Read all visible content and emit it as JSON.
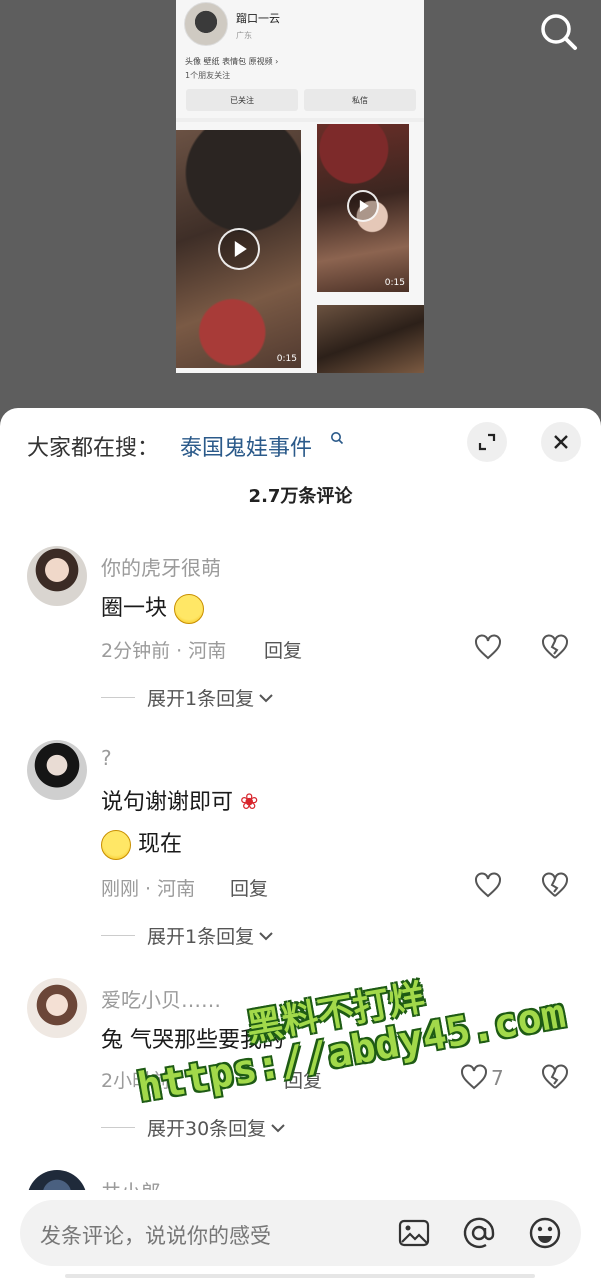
{
  "video_preview": {
    "profile_name": "蹓口一云",
    "location": "广东",
    "tags": "头像 壁纸 表情包 原视频 ›",
    "friends": "1个朋友关注",
    "follow_button": "已关注",
    "message_button": "私信",
    "thumb1_duration": "0:15",
    "thumb2_duration": "0:15"
  },
  "header": {
    "hot_search_prefix": "大家都在搜：",
    "hot_search_term": "泰国鬼娃事件",
    "comment_count": "2.7万条评论"
  },
  "comments": [
    {
      "username": "你的虎牙很萌",
      "text": "圈一块",
      "time_location": "2分钟前 · 河南",
      "reply_label": "回复",
      "expand_label": "展开1条回复"
    },
    {
      "username": "?",
      "text_line1": "说句谢谢即可",
      "text_line2": "现在",
      "time_location": "刚刚 · 河南",
      "reply_label": "回复",
      "expand_label": "展开1条回复"
    },
    {
      "username": "爱吃小贝……",
      "text": "兔 气哭那些要我的",
      "time_location": "2小时前",
      "reply_label": "回复",
      "like_count": "7",
      "expand_label": "展开30条回复"
    },
    {
      "username": "井小郎"
    }
  ],
  "input_bar": {
    "placeholder": "发条评论，说说你的感受"
  },
  "watermark": {
    "line1": "黑料不打烊",
    "line2": "https://abdy45.com"
  },
  "icons": {
    "search": "search-icon",
    "expand": "expand-icon",
    "close": "close-icon",
    "like": "heart-icon",
    "dislike": "broken-heart-icon",
    "image": "image-icon",
    "at": "at-icon",
    "emoji": "emoji-icon"
  }
}
